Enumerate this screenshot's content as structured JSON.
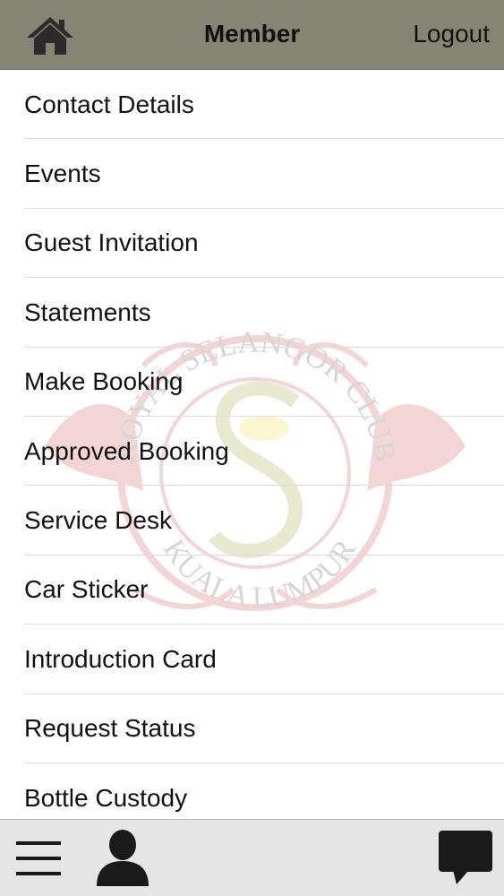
{
  "header": {
    "title": "Member",
    "logout_label": "Logout",
    "home_icon": "home-icon",
    "background_color": "#868571"
  },
  "menu": {
    "items": [
      {
        "label": "Contact Details"
      },
      {
        "label": "Events"
      },
      {
        "label": "Guest Invitation"
      },
      {
        "label": "Statements"
      },
      {
        "label": "Make Booking"
      },
      {
        "label": "Approved Booking"
      },
      {
        "label": "Service Desk"
      },
      {
        "label": "Car Sticker"
      },
      {
        "label": "Introduction Card"
      },
      {
        "label": "Request Status"
      },
      {
        "label": "Bottle Custody"
      }
    ],
    "watermark": {
      "top_text": "ROYAL SELANGOR CLUB",
      "bottom_text": "KUALA LUMPUR"
    }
  },
  "tabbar": {
    "icons": [
      "hamburger-menu-icon",
      "profile-icon",
      "chat-icon"
    ]
  }
}
